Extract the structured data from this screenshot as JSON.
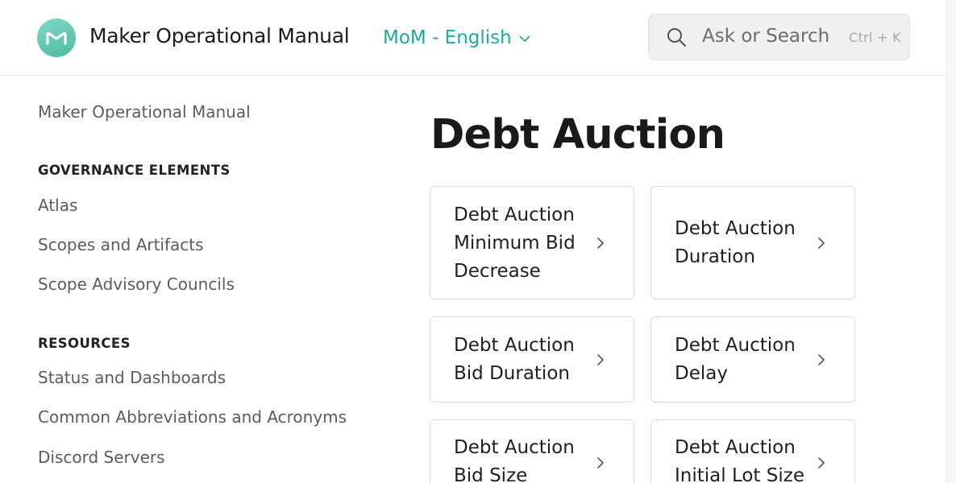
{
  "header": {
    "logo_icon": "maker-logo-icon",
    "title": "Maker Operational Manual",
    "space_switch": {
      "label": "MoM - English",
      "icon": "chevron-down-icon"
    },
    "search": {
      "placeholder": "Ask or Search",
      "shortcut": "Ctrl + K",
      "icon": "search-icon"
    }
  },
  "sidebar": {
    "top_link": "Maker Operational Manual",
    "sections": [
      {
        "title": "GOVERNANCE ELEMENTS",
        "items": [
          "Atlas",
          "Scopes and Artifacts",
          "Scope Advisory Councils"
        ]
      },
      {
        "title": "RESOURCES",
        "items": [
          "Status and Dashboards",
          "Common Abbreviations and Acronyms",
          "Discord Servers"
        ]
      }
    ]
  },
  "main": {
    "title": "Debt Auction",
    "cards": [
      {
        "label": "Debt Auction Minimum Bid Decrease"
      },
      {
        "label": "Debt Auction Duration"
      },
      {
        "label": "Debt Auction Bid Duration"
      },
      {
        "label": "Debt Auction Delay"
      },
      {
        "label": "Debt Auction Bid Size"
      },
      {
        "label": "Debt Auction Initial Lot Size"
      }
    ]
  },
  "colors": {
    "accent": "#1aab9b",
    "logo": "#5cc4ad",
    "search_bg": "#f0f0f0",
    "card_border": "#dcdcdc"
  }
}
